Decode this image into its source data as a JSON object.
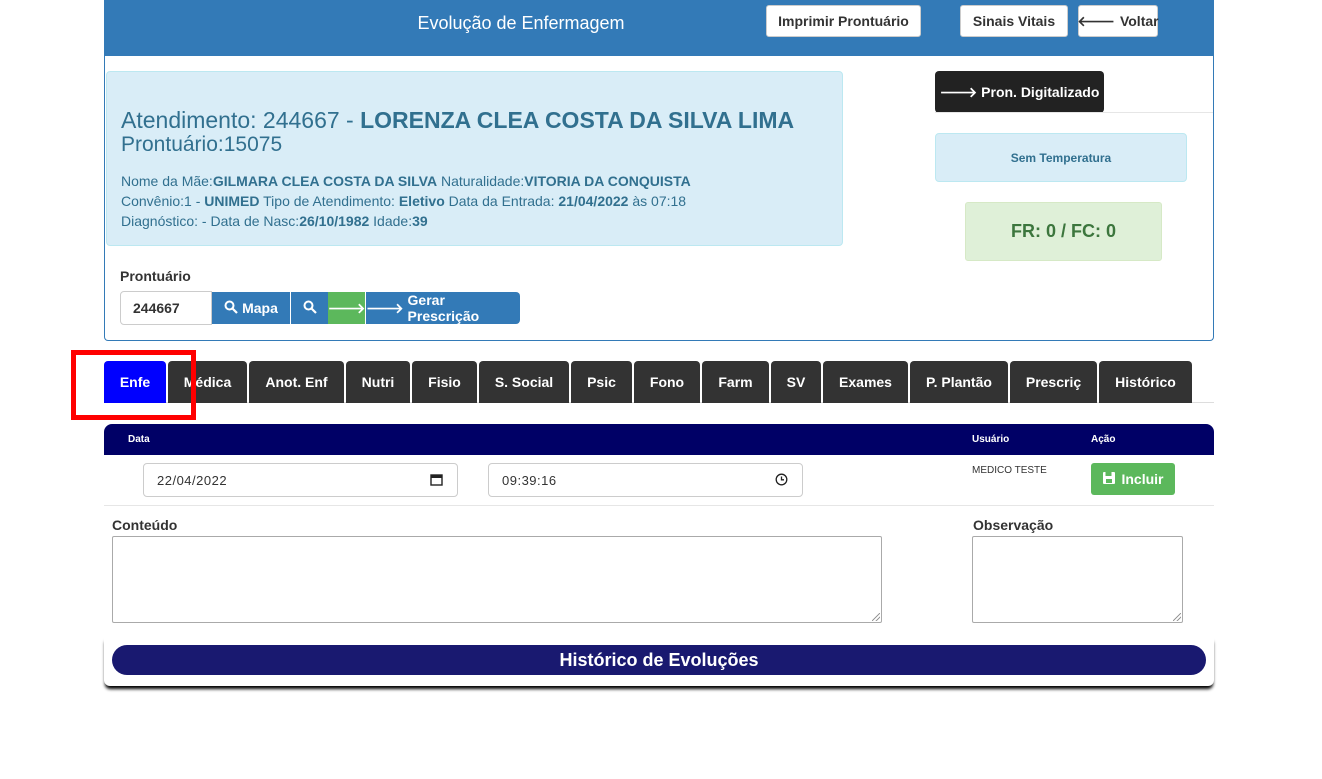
{
  "header": {
    "title": "Evolução de Enfermagem",
    "print_label": "Imprimir Prontuário",
    "vitals_label": "Sinais Vitais",
    "back_label": "Voltar"
  },
  "patient": {
    "attendance_prefix": "Atendimento: 244667 - ",
    "name": "LORENZA CLEA COSTA DA SILVA LIMA",
    "record_line": "Prontuário:15075",
    "mother_label": "Nome da Mãe:",
    "mother": "GILMARA CLEA COSTA DA SILVA",
    "naturality_label": " Naturalidade:",
    "naturality": "VITORIA DA CONQUISTA",
    "agreement_label": "Convênio:1 - ",
    "agreement": "UNIMED",
    "type_label": " Tipo de Atendimento: ",
    "type": "Eletivo",
    "entry_label": " Data da Entrada: ",
    "entry": "21/04/2022",
    "entry_time": " às 07:18",
    "diag_label": "Diagnóstico: - Data de Nasc:",
    "birth": "26/10/1982",
    "age_label": " Idade:",
    "age": "39"
  },
  "side": {
    "digitized_label": "Pron. Digitalizado",
    "temperature": "Sem Temperatura",
    "fr_fc": "FR: 0 / FC: 0"
  },
  "record_search": {
    "label": "Prontuário",
    "value": "244667",
    "map_label": "Mapa",
    "generate_label": "Gerar Prescrição"
  },
  "tabs": [
    "Enfe",
    "Médica",
    "Anot. Enf",
    "Nutri",
    "Fisio",
    "S. Social",
    "Psic",
    "Fono",
    "Farm",
    "SV",
    "Exames",
    "P. Plantão",
    "Prescriç",
    "Histórico"
  ],
  "form": {
    "col_date": "Data",
    "col_user": "Usuário",
    "col_action": "Ação",
    "date_value": "22/04/2022",
    "time_value": "09:39:16",
    "user": "MEDICO TESTE",
    "include_label": "Incluir",
    "content_label": "Conteúdo",
    "observation_label": "Observação"
  },
  "history": {
    "title": "Histórico de Evoluções"
  },
  "colors": {
    "header_blue": "#337ab7",
    "active_tab": "#0000ff",
    "table_header": "#000066",
    "highlight": "#ff0000"
  }
}
